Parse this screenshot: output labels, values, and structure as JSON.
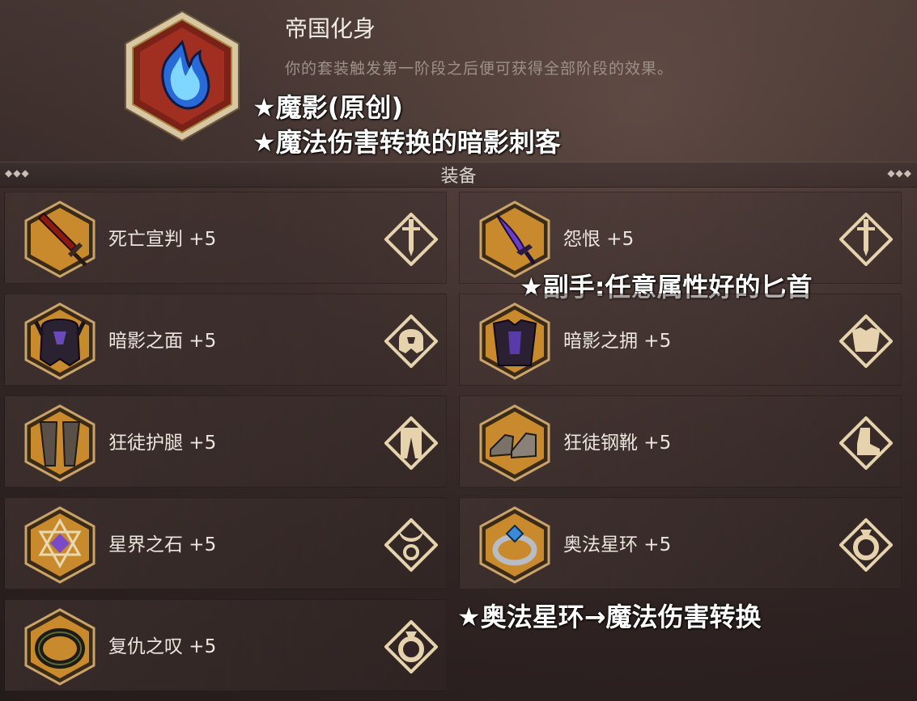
{
  "set": {
    "title": "帝国化身",
    "description": "你的套装触发第一阶段之后便可获得全部阶段的效果。",
    "icon": "blue-flame-icon"
  },
  "notes": {
    "note1": "★魔影(原创)",
    "note2": "★魔法伤害转换的暗影刺客",
    "note3": "★副手:任意属性好的匕首",
    "note4": "★奥法星环→魔法伤害转换"
  },
  "section": {
    "title": "装备",
    "dots_left": "◆◆◆",
    "dots_right": "◆◆◆"
  },
  "equipment": [
    {
      "name": "死亡宣判 +5",
      "icon": "red-sword-icon",
      "type_icon": "mainhand-type-icon"
    },
    {
      "name": "怨恨 +5",
      "icon": "purple-dagger-icon",
      "type_icon": "offhand-type-icon"
    },
    {
      "name": "暗影之面 +5",
      "icon": "dark-helmet-icon",
      "type_icon": "helmet-type-icon"
    },
    {
      "name": "暗影之拥 +5",
      "icon": "dark-chestplate-icon",
      "type_icon": "chest-type-icon"
    },
    {
      "name": "狂徒护腿 +5",
      "icon": "leggings-icon",
      "type_icon": "legs-type-icon"
    },
    {
      "name": "狂徒钢靴 +5",
      "icon": "boots-icon",
      "type_icon": "boots-type-icon"
    },
    {
      "name": "星界之石 +5",
      "icon": "star-amulet-icon",
      "type_icon": "amulet-type-icon"
    },
    {
      "name": "奥法星环 +5",
      "icon": "arcane-ring-icon",
      "type_icon": "ring-type-icon"
    },
    {
      "name": "复仇之叹 +5",
      "icon": "dark-ring-icon",
      "type_icon": "ring-type-icon"
    }
  ],
  "colors": {
    "frame_gold": "#c9a36a",
    "icon_orange": "#c98a2e",
    "text": "#ece6df"
  }
}
